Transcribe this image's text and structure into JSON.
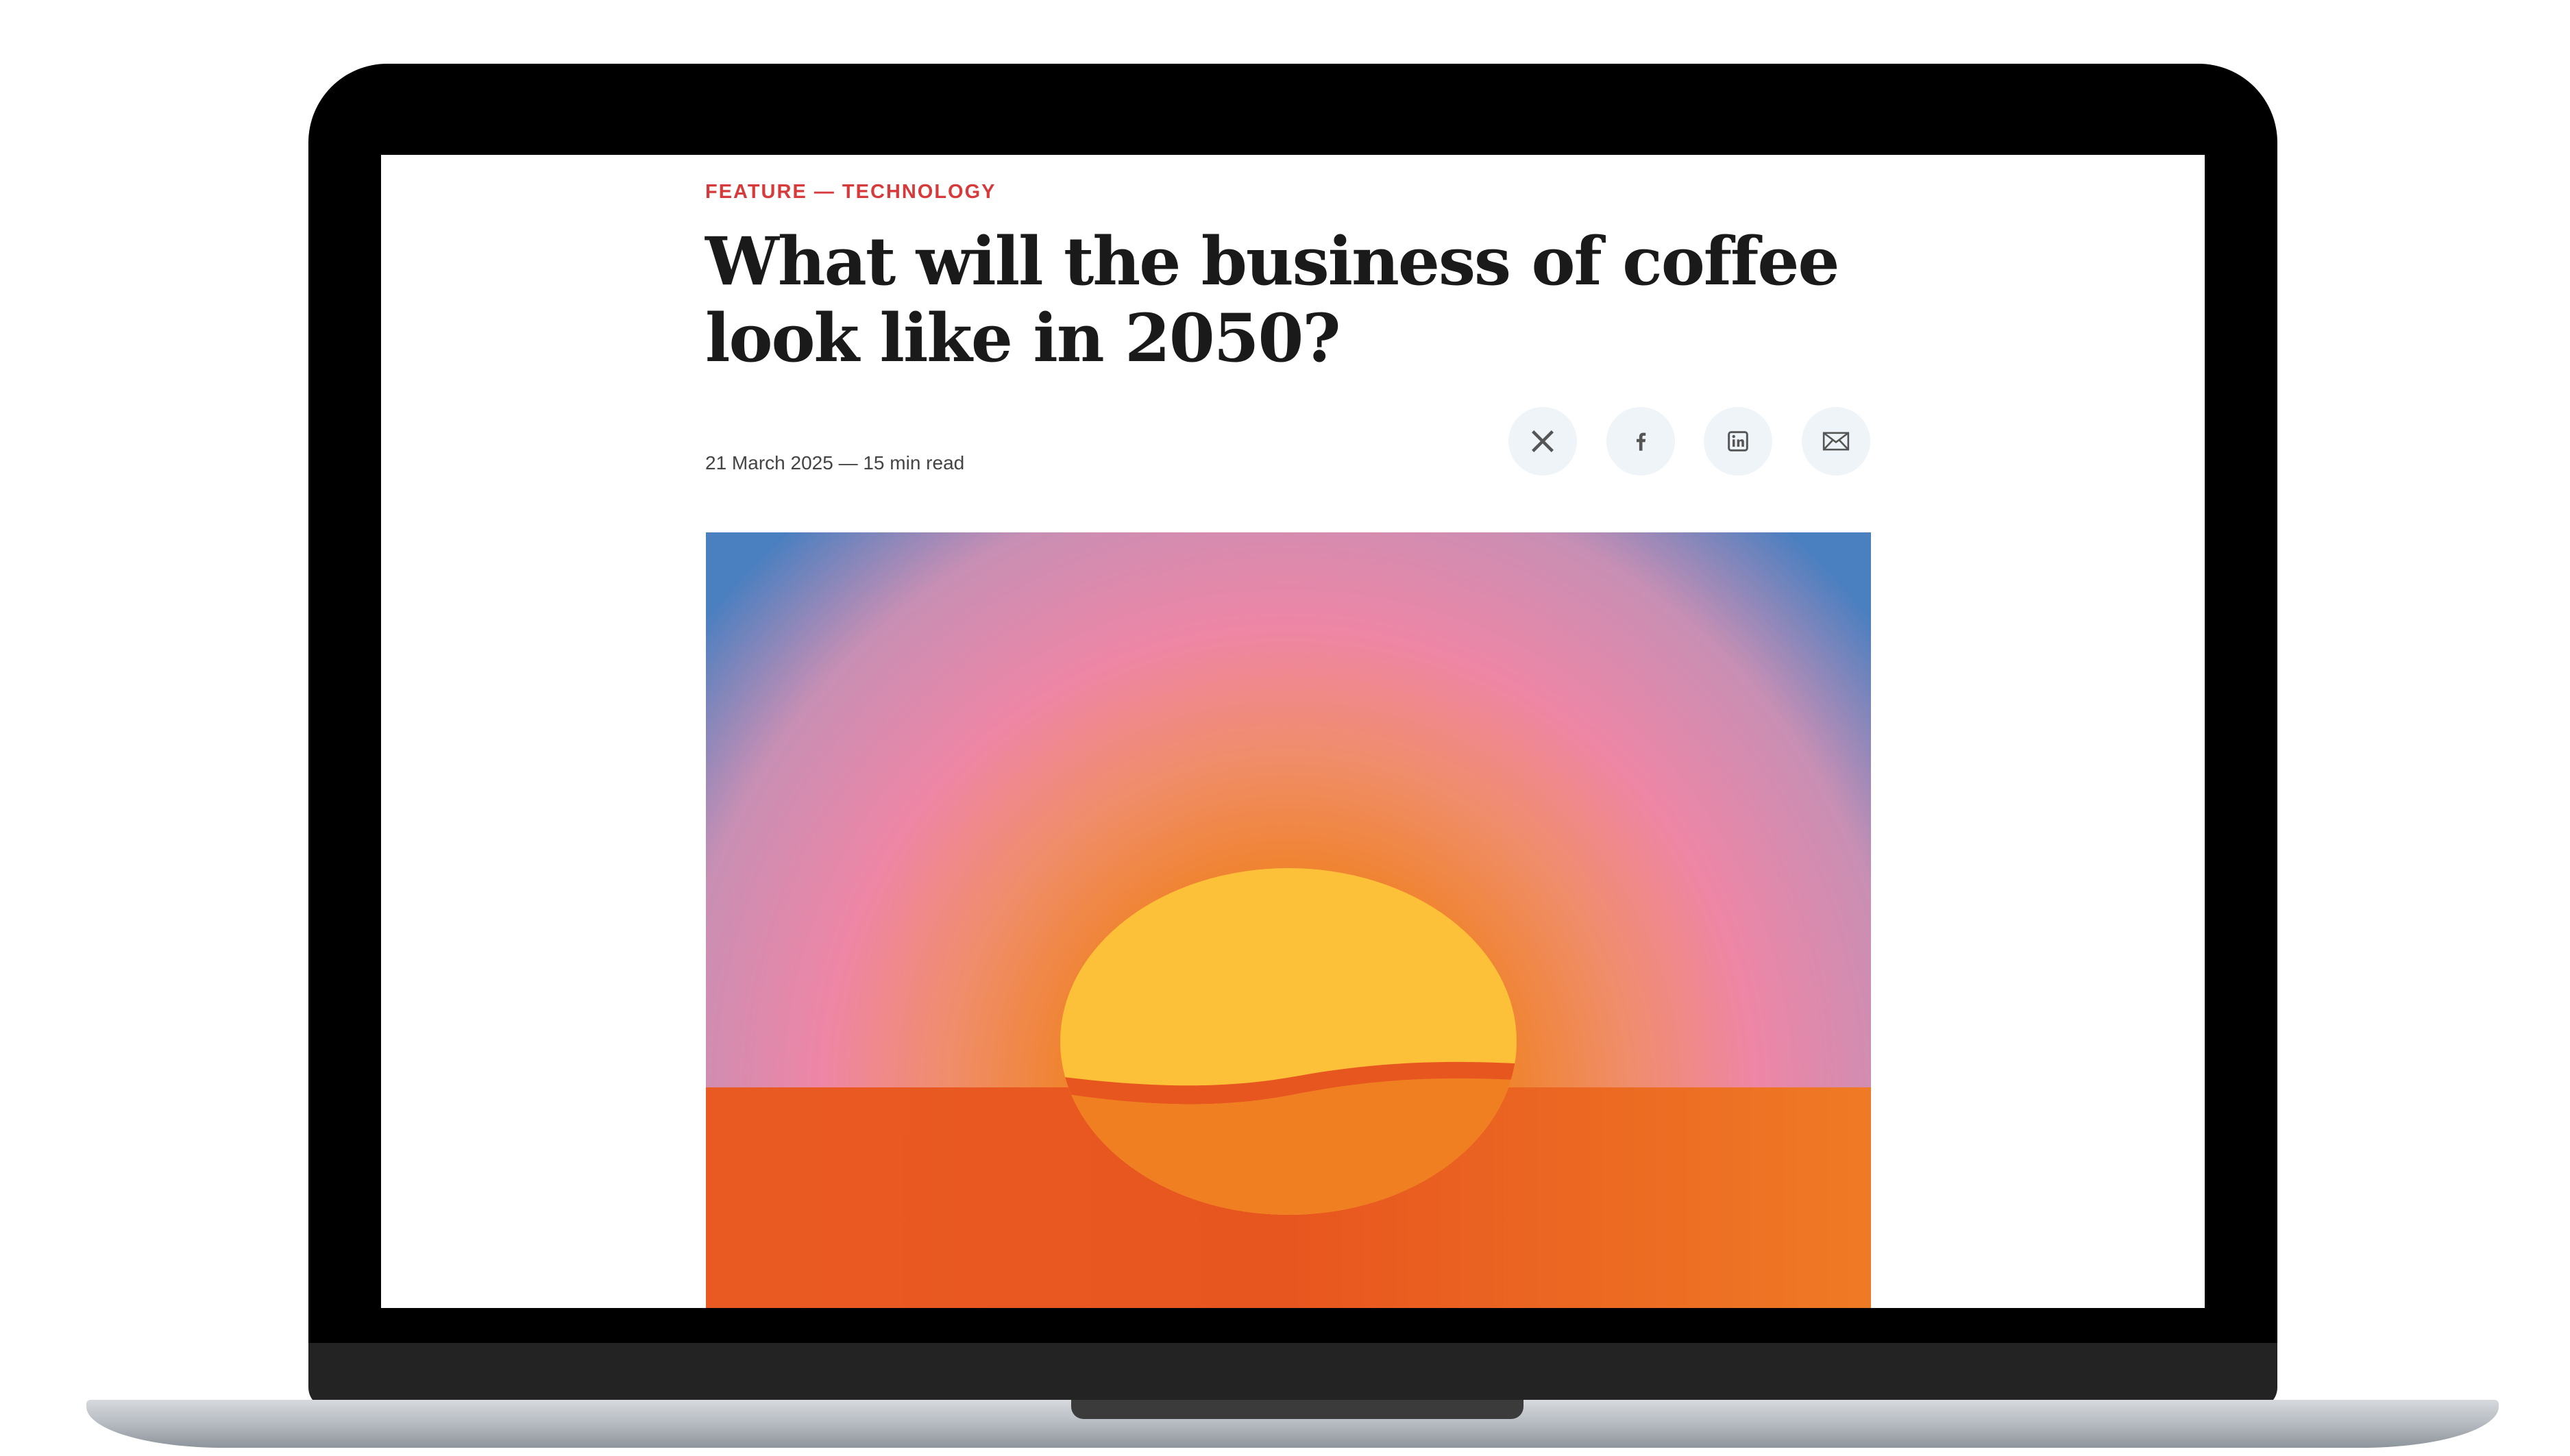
{
  "article": {
    "kicker": "FEATURE — TECHNOLOGY",
    "title_line1": "What will the business of coffee",
    "title_line2": "look like in 2050?",
    "date": "21 March 2025",
    "separator": "—",
    "read_time": "15 min read"
  },
  "share": [
    {
      "icon": "x-icon",
      "label": "X"
    },
    {
      "icon": "facebook-icon",
      "label": "Facebook"
    },
    {
      "icon": "linkedin-icon",
      "label": "LinkedIn"
    },
    {
      "icon": "email-icon",
      "label": "Email"
    }
  ],
  "hero_image": {
    "subject": "coffee bean sunrise illustration",
    "colors": {
      "sky_top": "#4a7fc0",
      "sky_pink": "#ee86a6",
      "glow_orange": "#f08a1a",
      "sun_yellow": "#fcc138",
      "sun_lower": "#f07e22",
      "ground": "#e85a22"
    }
  },
  "colors": {
    "accent": "#d63a3a",
    "text": "#1a1a1a",
    "meta": "#444444",
    "share_bg": "#eef4f7"
  }
}
